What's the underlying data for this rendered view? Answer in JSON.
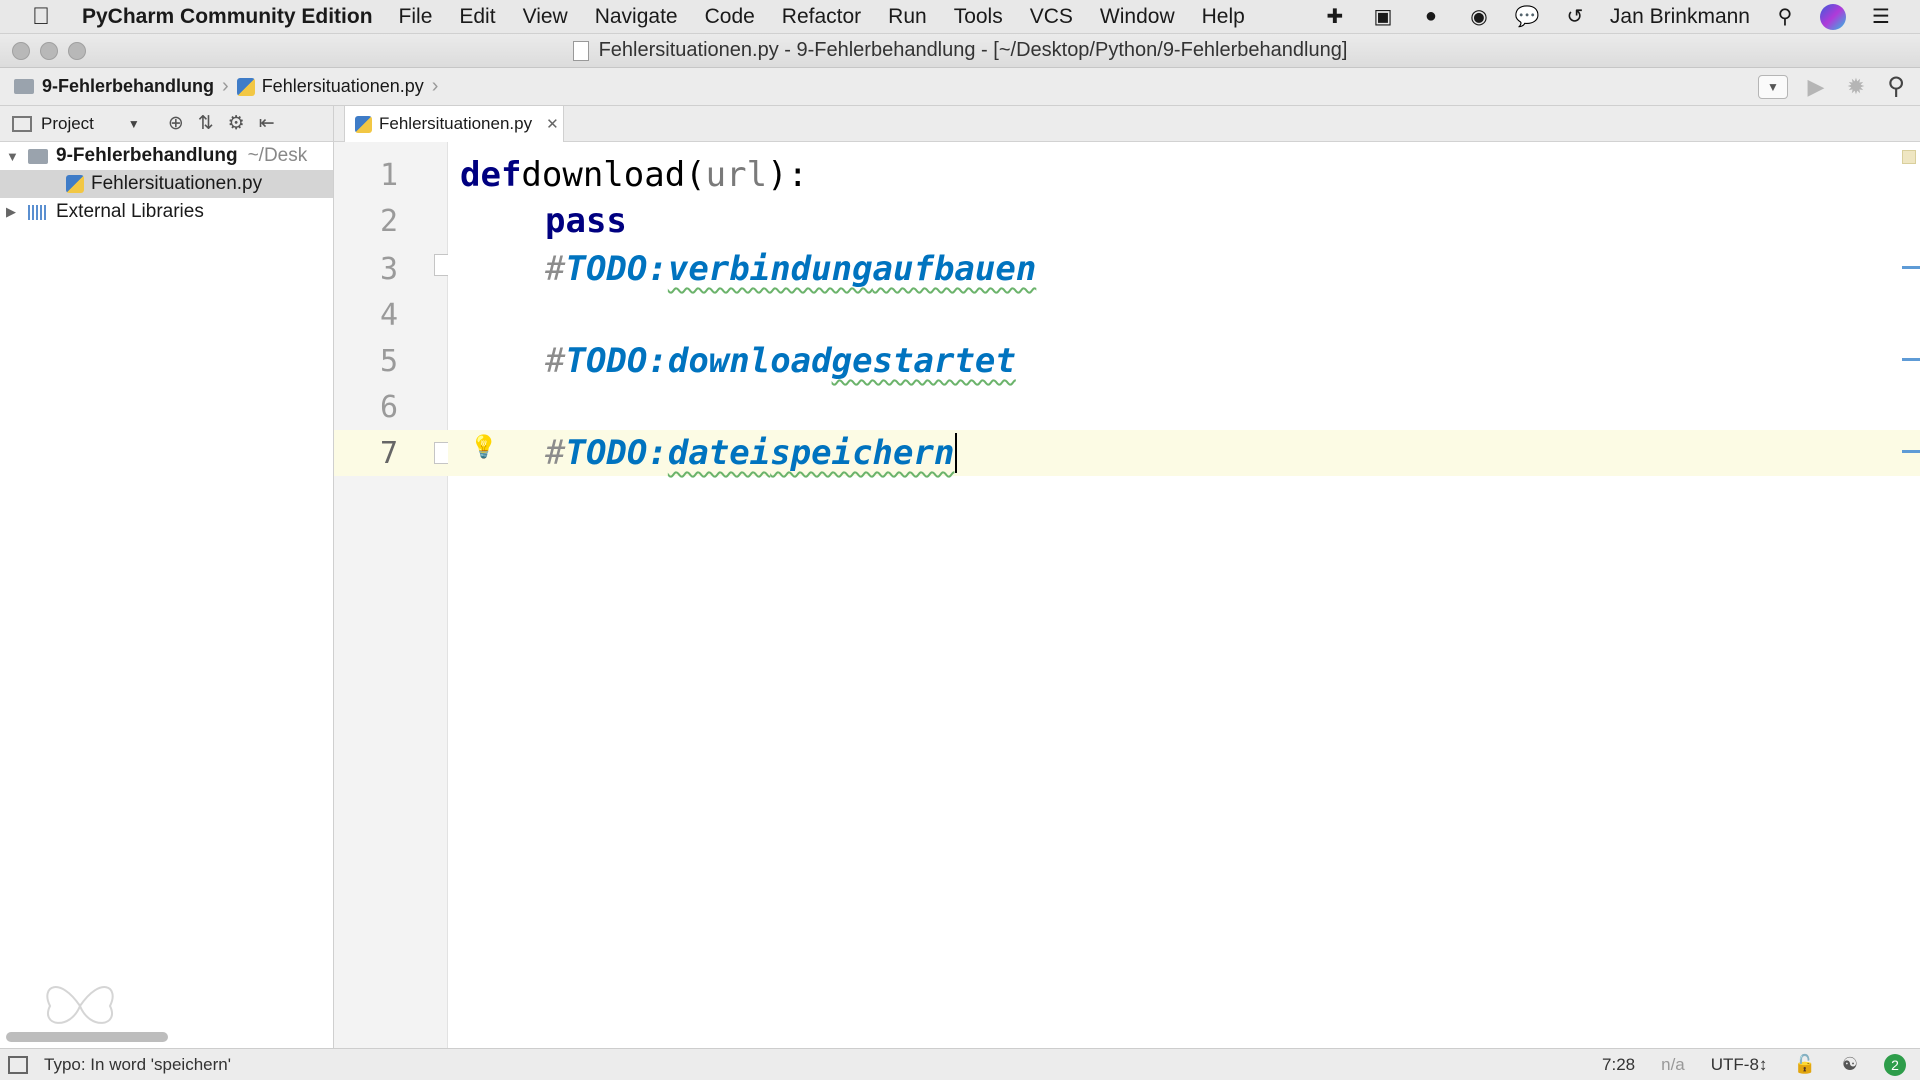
{
  "menubar": {
    "app_name": "PyCharm Community Edition",
    "items": [
      "File",
      "Edit",
      "View",
      "Navigate",
      "Code",
      "Refactor",
      "Run",
      "Tools",
      "VCS",
      "Window",
      "Help"
    ],
    "user": "Jan Brinkmann"
  },
  "window": {
    "title": "Fehlersituationen.py - 9-Fehlerbehandlung - [~/Desktop/Python/9-Fehlerbehandlung]"
  },
  "breadcrumb": {
    "project": "9-Fehlerbehandlung",
    "file": "Fehlersituationen.py"
  },
  "project_panel": {
    "view_label": "Project",
    "root": "9-Fehlerbehandlung",
    "root_hint": "~/Desk",
    "file": "Fehlersituationen.py",
    "external": "External Libraries"
  },
  "editor": {
    "tab_label": "Fehlersituationen.py",
    "line_numbers": [
      "1",
      "2",
      "3",
      "4",
      "5",
      "6",
      "7"
    ],
    "l1_kw": "def",
    "l1_fn": "download(",
    "l1_param": "url",
    "l1_end": "):",
    "l2_kw": "pass",
    "hash": "#",
    "todo": "TODO:",
    "l3_w1": "verbindung",
    "l3_w2": "aufbauen",
    "l5_w1": "download",
    "l5_w2": "gestartet",
    "l7_w1": "datei",
    "l7_w2": "speichern"
  },
  "statusbar": {
    "message": "Typo: In word 'speichern'",
    "position": "7:28",
    "na": "n/a",
    "encoding": "UTF-8↕",
    "notifications": "2"
  },
  "colors": {
    "keyword": "#000080",
    "todo": "#0073bf",
    "current_line": "#fcfbe4"
  }
}
